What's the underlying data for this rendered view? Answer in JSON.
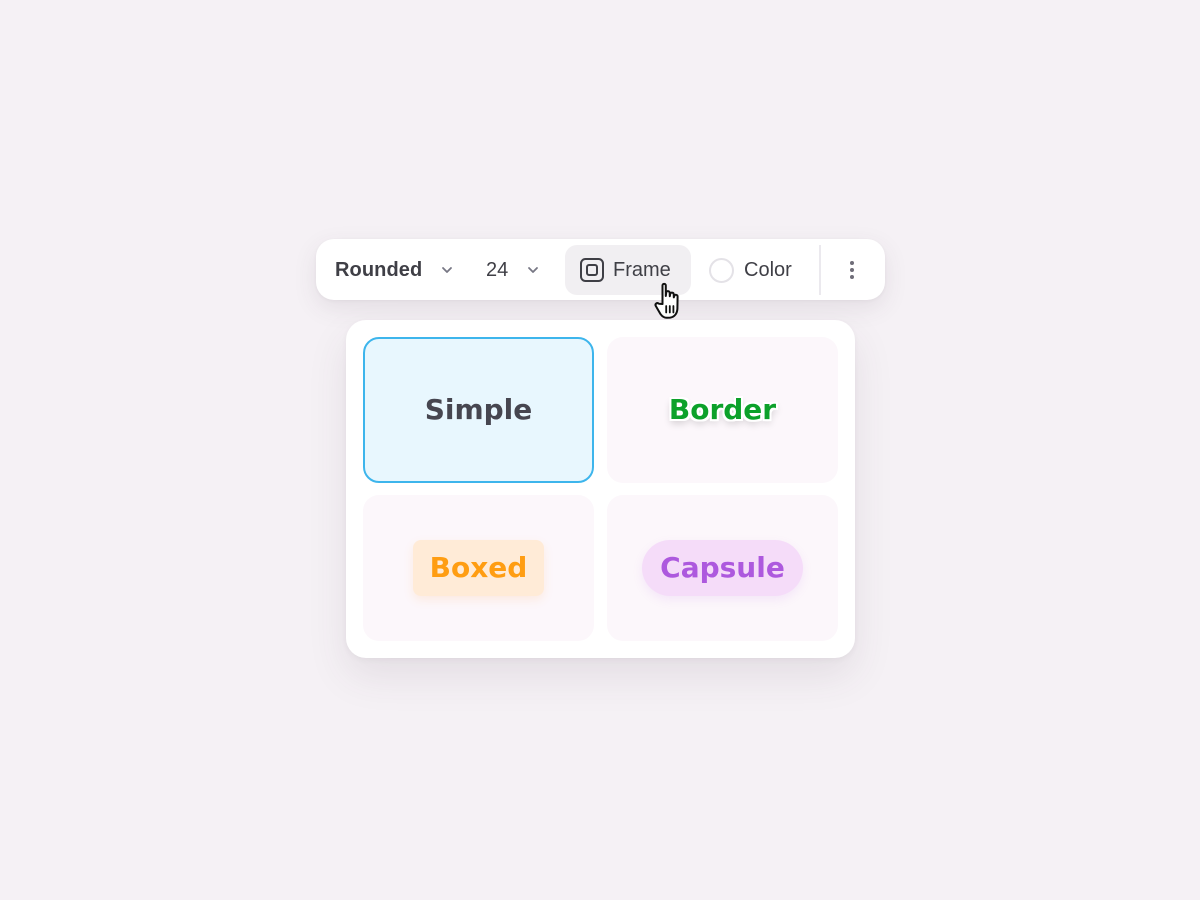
{
  "toolbar": {
    "font_style": "Rounded",
    "font_size": "24",
    "frame_label": "Frame",
    "color_label": "Color",
    "icons": {
      "font_chevron": "chevron-down-icon",
      "size_chevron": "chevron-down-icon",
      "frame": "frame-icon",
      "swatch": "color-swatch-circle",
      "more": "more-vertical-icon",
      "cursor": "hand-pointer-cursor"
    }
  },
  "frame_menu": {
    "selected": "Simple",
    "options": [
      {
        "label": "Simple",
        "text_color": "#464650",
        "background": "#e8f7fe",
        "border": "#3db5ec"
      },
      {
        "label": "Border",
        "text_color": "#0ca12a",
        "outline": "#ffffff"
      },
      {
        "label": "Boxed",
        "text_color": "#ff9d12",
        "background": "#ffebd7"
      },
      {
        "label": "Capsule",
        "text_color": "#ad59de",
        "background": "#f5dcf9"
      }
    ]
  },
  "colors": {
    "page_background": "#f5f1f5",
    "surface": "#ffffff",
    "active_button_background": "#f1eff2",
    "selection_accent": "#3db5ec"
  }
}
